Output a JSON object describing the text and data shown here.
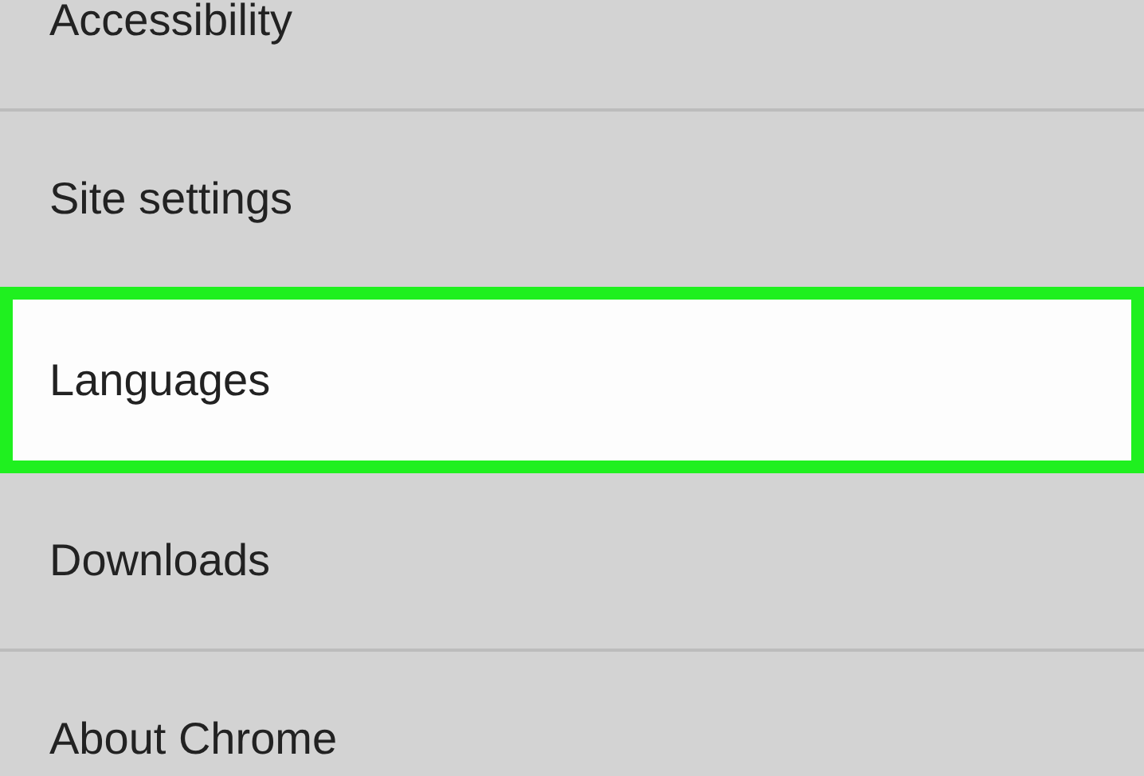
{
  "settings_items": [
    {
      "label": "Accessibility",
      "selected": false
    },
    {
      "label": "Site settings",
      "selected": false
    },
    {
      "label": "Languages",
      "selected": true
    },
    {
      "label": "Downloads",
      "selected": false
    },
    {
      "label": "About Chrome",
      "selected": false
    }
  ]
}
